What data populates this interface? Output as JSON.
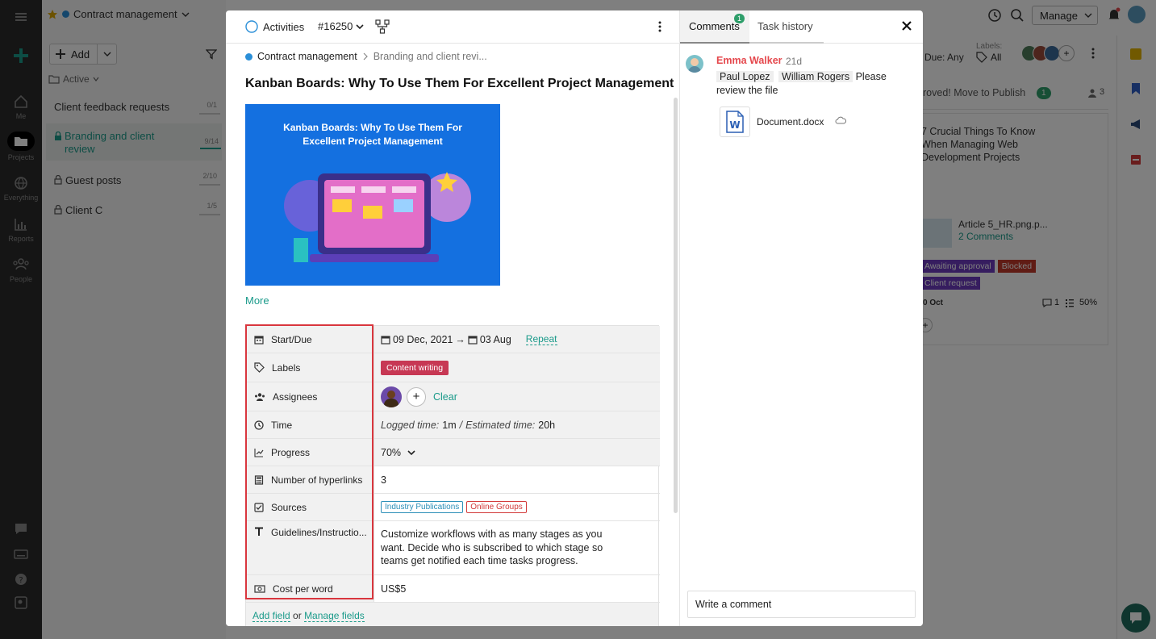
{
  "colors": {
    "accent": "#1a9a8a",
    "brand_red": "#e5484d",
    "label_red": "#c73854",
    "tag_blue": "#2b8fb8",
    "tag_red": "#d23a3a",
    "badge_green": "#2e9e6a"
  },
  "app": {
    "topbar": {
      "project_name": "Contract management",
      "manage_label": "Manage"
    },
    "left_rail": {
      "items": [
        {
          "label": "Me",
          "icon": "home-icon"
        },
        {
          "label": "Projects",
          "icon": "folder-icon"
        },
        {
          "label": "Everything",
          "icon": "globe-icon"
        },
        {
          "label": "Reports",
          "icon": "bar-chart-icon"
        },
        {
          "label": "People",
          "icon": "people-icon"
        }
      ]
    },
    "project_panel": {
      "add_label": "Add",
      "filter_label": "Active",
      "items": [
        {
          "name": "Client feedback requests",
          "count": "0/1"
        },
        {
          "name": "Branding and client review",
          "count": "9/14"
        },
        {
          "name": "Guest posts",
          "count": "2/10"
        },
        {
          "name": "Client C",
          "count": "1/5"
        }
      ]
    },
    "board": {
      "due_filter": "Due: Any",
      "labels_title": "Labels:",
      "labels_value": "All",
      "column_title": "roved! Move to Publish",
      "column_count": "1",
      "column_people": "3",
      "card_title": "7 Crucial Things To Know When Managing Web Development Projects",
      "card_attachment": "Article 5_HR.png.p...",
      "card_comments": "2 Comments",
      "card_tags": [
        "Awaiting approval",
        "Blocked",
        "Client request"
      ],
      "card_date": "0 Oct",
      "card_comment_count": "1",
      "card_progress": "50%"
    }
  },
  "modal": {
    "header": {
      "activities_label": "Activities",
      "task_id": "#16250"
    },
    "breadcrumb": {
      "project": "Contract management",
      "task": "Branding and client revi..."
    },
    "title": "Kanban Boards: Why To Use Them For Excellent Project Management",
    "cover_image": {
      "headline": "Kanban Boards: Why To Use Them For Excellent Project Management"
    },
    "more_label": "More",
    "fields": {
      "start_due": {
        "name": "Start/Due",
        "start": "09 Dec, 2021",
        "due": "03 Aug",
        "repeat": "Repeat"
      },
      "labels": {
        "name": "Labels",
        "value": "Content writing"
      },
      "assignees": {
        "name": "Assignees",
        "clear": "Clear"
      },
      "time": {
        "name": "Time",
        "logged_label": "Logged time:",
        "logged_value": "1m",
        "sep": "/",
        "estimated_label": "Estimated time:",
        "estimated_value": "20h"
      },
      "progress": {
        "name": "Progress",
        "value": "70%"
      },
      "hyperlinks": {
        "name": "Number of hyperlinks",
        "value": "3"
      },
      "sources": {
        "name": "Sources",
        "tags": [
          "Industry Publications",
          "Online Groups"
        ]
      },
      "guidelines": {
        "name": "Guidelines/Instructio...",
        "line1": "Customize workflows with as many stages as you",
        "line2": "want. Decide who is subscribed to which stage so",
        "line3": "teams get notified each time tasks progress."
      },
      "cost": {
        "name": "Cost per word",
        "value": "US$5"
      }
    },
    "footer": {
      "add_field": "Add field",
      "or": "or",
      "manage_fields": "Manage fields"
    },
    "comments_panel": {
      "tabs": [
        {
          "label": "Comments",
          "badge": "1"
        },
        {
          "label": "Task history"
        }
      ],
      "comment": {
        "author": "Emma Walker",
        "age": "21d",
        "mention1": "Paul Lopez",
        "mention2": "William Rogers",
        "text1": "Please",
        "text2": "review the file",
        "attachment": "Document.docx"
      },
      "input_placeholder": "Write a comment"
    }
  }
}
